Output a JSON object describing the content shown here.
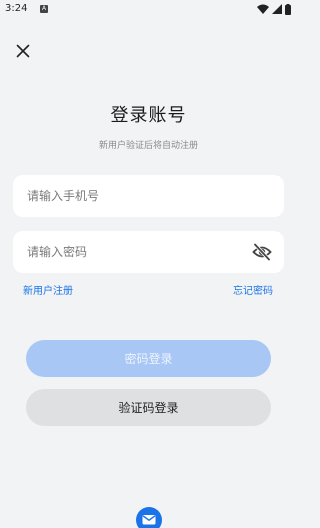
{
  "status_bar": {
    "time": "3:24",
    "notification_letter": "A"
  },
  "page": {
    "title": "登录账号",
    "subtitle": "新用户验证后将自动注册"
  },
  "form": {
    "phone_placeholder": "请输入手机号",
    "password_placeholder": "请输入密码"
  },
  "links": {
    "register": "新用户注册",
    "forgot_password": "忘记密码"
  },
  "buttons": {
    "password_login": "密码登录",
    "code_login": "验证码登录"
  },
  "colors": {
    "accent": "#1a73e8",
    "primary_button_disabled": "#a9c7f5",
    "secondary_button": "#dfe0e2",
    "background": "#f2f3f5"
  },
  "icons": [
    "close-icon",
    "eye-off-icon",
    "mail-icon",
    "wifi-icon",
    "signal-icon",
    "battery-icon"
  ]
}
